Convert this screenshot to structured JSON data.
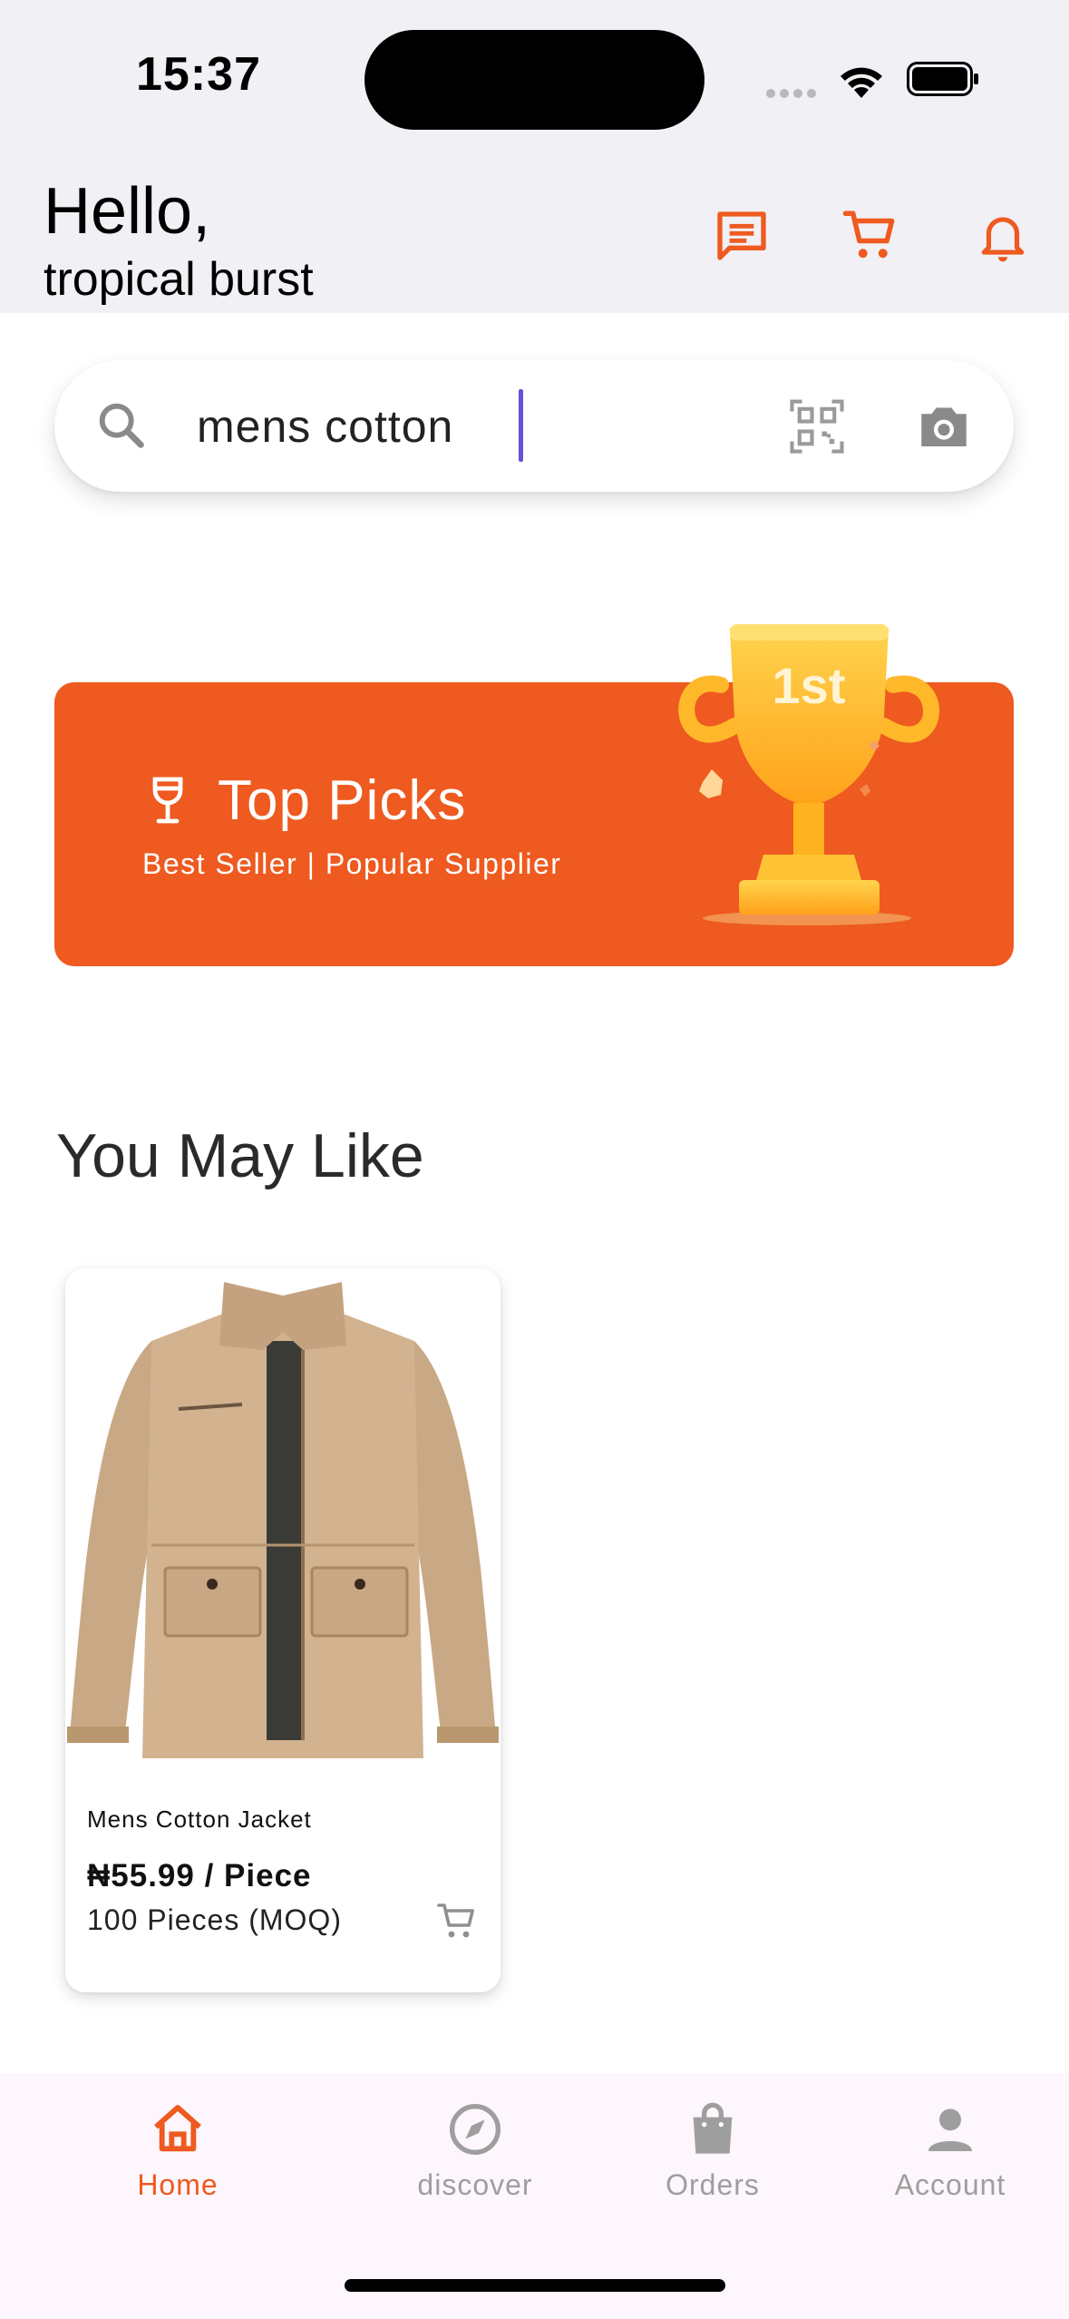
{
  "status_bar": {
    "time": "15:37"
  },
  "header": {
    "greeting": "Hello,",
    "user_name": "tropical burst",
    "accent_color": "#ee5a1f",
    "icons": [
      "message-icon",
      "cart-icon",
      "bell-icon"
    ]
  },
  "search": {
    "value": "mens cotton",
    "icons": [
      "search-icon",
      "qr-scan-icon",
      "camera-icon"
    ]
  },
  "banner": {
    "title": "Top Picks",
    "subtitle": "Best Seller | Popular Supplier",
    "badge_text": "1st",
    "background_color": "#ee5a1f"
  },
  "section": {
    "title": "You May Like"
  },
  "products": [
    {
      "name": "Mens Cotton Jacket",
      "price": "₦55.99 / Piece",
      "moq": "100 Pieces (MOQ)"
    }
  ],
  "bottom_nav": {
    "items": [
      {
        "label": "Home",
        "icon": "home-icon",
        "active": true
      },
      {
        "label": "discover",
        "icon": "compass-icon",
        "active": false
      },
      {
        "label": "Orders",
        "icon": "bag-icon",
        "active": false
      },
      {
        "label": "Account",
        "icon": "person-icon",
        "active": false
      }
    ],
    "active_color": "#ee5a1f",
    "inactive_color": "#9e9e9e"
  }
}
